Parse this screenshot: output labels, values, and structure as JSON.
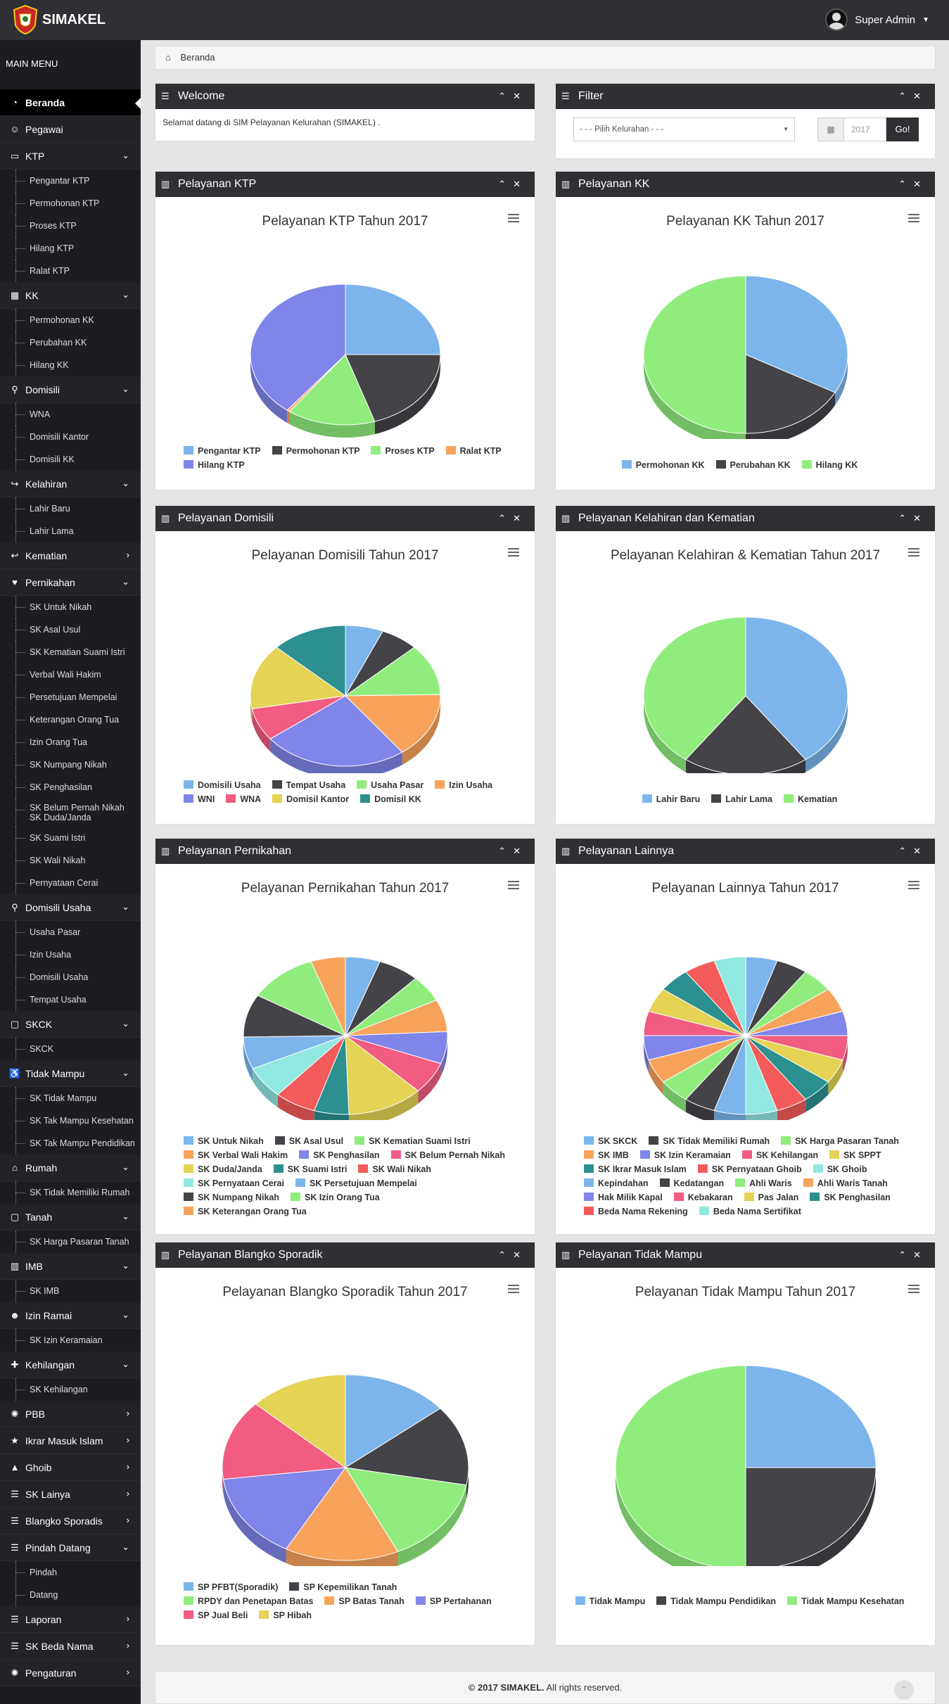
{
  "app": {
    "title": "SIMAKEL",
    "user": "Super Admin"
  },
  "sidebar": {
    "heading": "MAIN MENU",
    "items": [
      {
        "type": "item",
        "label": "Beranda",
        "icon": "dashboard-icon",
        "active": true
      },
      {
        "type": "item",
        "label": "Pegawai",
        "icon": "user-icon"
      },
      {
        "type": "item",
        "label": "KTP",
        "icon": "id-card-icon",
        "chev": "down"
      },
      {
        "type": "sub",
        "label": "Pengantar KTP"
      },
      {
        "type": "sub",
        "label": "Permohonan KTP"
      },
      {
        "type": "sub",
        "label": "Proses KTP"
      },
      {
        "type": "sub",
        "label": "Hilang KTP"
      },
      {
        "type": "sub",
        "label": "Ralat KTP"
      },
      {
        "type": "item",
        "label": "KK",
        "icon": "grid-icon",
        "chev": "down"
      },
      {
        "type": "sub",
        "label": "Permohonan KK"
      },
      {
        "type": "sub",
        "label": "Perubahan KK"
      },
      {
        "type": "sub",
        "label": "Hilang KK"
      },
      {
        "type": "item",
        "label": "Domisili",
        "icon": "map-marker-icon",
        "chev": "down"
      },
      {
        "type": "sub",
        "label": "WNA"
      },
      {
        "type": "sub",
        "label": "Domisili Kantor"
      },
      {
        "type": "sub",
        "label": "Domisili KK"
      },
      {
        "type": "item",
        "label": "Kelahiran",
        "icon": "share-icon",
        "chev": "down"
      },
      {
        "type": "sub",
        "label": "Lahir Baru"
      },
      {
        "type": "sub",
        "label": "Lahir Lama"
      },
      {
        "type": "item",
        "label": "Kematian",
        "icon": "reply-icon",
        "chev": "right"
      },
      {
        "type": "item",
        "label": "Pernikahan",
        "icon": "heart-icon",
        "chev": "down"
      },
      {
        "type": "sub",
        "label": "SK Untuk Nikah"
      },
      {
        "type": "sub",
        "label": "SK Asal Usul"
      },
      {
        "type": "sub",
        "label": "SK Kematian Suami Istri"
      },
      {
        "type": "sub",
        "label": "Verbal Wali Hakim"
      },
      {
        "type": "sub",
        "label": "Persetujuan Mempelai"
      },
      {
        "type": "sub",
        "label": "Keterangan Orang Tua"
      },
      {
        "type": "sub",
        "label": "Izin Orang Tua"
      },
      {
        "type": "sub",
        "label": "SK Numpang Nikah"
      },
      {
        "type": "sub",
        "label": "SK Penghasilan"
      },
      {
        "type": "sub2",
        "label": "SK Belum Pernah Nikah SK Duda/Janda"
      },
      {
        "type": "sub",
        "label": "SK Suami Istri"
      },
      {
        "type": "sub",
        "label": "SK Wali Nikah"
      },
      {
        "type": "sub",
        "label": "Pernyataan Cerai"
      },
      {
        "type": "item",
        "label": "Domisili Usaha",
        "icon": "map-marker-icon",
        "chev": "down"
      },
      {
        "type": "sub",
        "label": "Usaha Pasar"
      },
      {
        "type": "sub",
        "label": "Izin Usaha"
      },
      {
        "type": "sub",
        "label": "Domisili Usaha"
      },
      {
        "type": "sub",
        "label": "Tempat Usaha"
      },
      {
        "type": "item",
        "label": "SKCK",
        "icon": "folder-icon",
        "chev": "down"
      },
      {
        "type": "sub",
        "label": "SKCK"
      },
      {
        "type": "item",
        "label": "Tidak Mampu",
        "icon": "wheelchair-icon",
        "chev": "down"
      },
      {
        "type": "sub",
        "label": "SK Tidak Mampu"
      },
      {
        "type": "sub",
        "label": "SK Tak Mampu Kesehatan"
      },
      {
        "type": "sub",
        "label": "SK Tak Mampu Pendidikan"
      },
      {
        "type": "item",
        "label": "Rumah",
        "icon": "home-icon",
        "chev": "down"
      },
      {
        "type": "sub",
        "label": "SK Tidak Memiliki Rumah"
      },
      {
        "type": "item",
        "label": "Tanah",
        "icon": "folder-icon",
        "chev": "down"
      },
      {
        "type": "sub",
        "label": "SK Harga Pasaran Tanah"
      },
      {
        "type": "item",
        "label": "IMB",
        "icon": "building-icon",
        "chev": "down"
      },
      {
        "type": "sub",
        "label": "SK IMB"
      },
      {
        "type": "item",
        "label": "Izin Ramai",
        "icon": "users-icon",
        "chev": "down"
      },
      {
        "type": "sub",
        "label": "SK Izin Keramaian"
      },
      {
        "type": "item",
        "label": "Kehilangan",
        "icon": "puzzle-icon",
        "chev": "down"
      },
      {
        "type": "sub",
        "label": "SK Kehilangan"
      },
      {
        "type": "item",
        "label": "PBB",
        "icon": "gear-icon",
        "chev": "right"
      },
      {
        "type": "item",
        "label": "Ikrar Masuk Islam",
        "icon": "star-icon",
        "chev": "right"
      },
      {
        "type": "item",
        "label": "Ghoib",
        "icon": "warning-icon",
        "chev": "right"
      },
      {
        "type": "item",
        "label": "SK Lainya",
        "icon": "list-icon",
        "chev": "right"
      },
      {
        "type": "item",
        "label": "Blangko Sporadis",
        "icon": "list-icon",
        "chev": "right"
      },
      {
        "type": "item",
        "label": "Pindah Datang",
        "icon": "list-icon",
        "chev": "down"
      },
      {
        "type": "sub",
        "label": "Pindah"
      },
      {
        "type": "sub",
        "label": "Datang"
      },
      {
        "type": "item",
        "label": "Laporan",
        "icon": "list-icon",
        "chev": "right"
      },
      {
        "type": "item",
        "label": "SK Beda Nama",
        "icon": "list-icon",
        "chev": "right"
      },
      {
        "type": "item",
        "label": "Pengaturan",
        "icon": "gear-icon",
        "chev": "right"
      }
    ]
  },
  "breadcrumb": "Beranda",
  "welcome": {
    "title": "Welcome",
    "text": "Selamat datang di SIM Pelayanan Kelurahan (SIMAKEL) ."
  },
  "filter": {
    "title": "Filter",
    "select": "- - - Pilih Kelurahan - - -",
    "year": "2017",
    "button": "Go!"
  },
  "footer": {
    "bold": "© 2017 SIMAKEL.",
    "rest": " All rights reserved."
  },
  "colors": [
    "#7cb5ec",
    "#434348",
    "#90ed7d",
    "#f7a35c",
    "#8085e9",
    "#f15c80",
    "#e4d354",
    "#2b908f",
    "#f45b5b",
    "#91e8e1"
  ],
  "chart_data": [
    {
      "panel": "Pelayanan KTP",
      "type": "pie",
      "title": "Pelayanan KTP Tahun 2017",
      "categories": [
        "Pengantar KTP",
        "Permohonan KTP",
        "Proses KTP",
        "Ralat KTP",
        "Hilang KTP"
      ],
      "values": [
        25,
        20,
        15,
        0.5,
        39.5
      ]
    },
    {
      "panel": "Pelayanan KK",
      "type": "pie",
      "title": "Pelayanan KK Tahun 2017",
      "categories": [
        "Permohonan KK",
        "Perubahan KK",
        "Hilang KK"
      ],
      "values": [
        33,
        17,
        50
      ]
    },
    {
      "panel": "Pelayanan Domisili",
      "type": "pie",
      "title": "Pelayanan Domisili Tahun 2017",
      "categories": [
        "Domisili Usaha",
        "Tempat Usaha",
        "Usaha Pasar",
        "Izin Usaha",
        "WNI",
        "WNA",
        "Domisil Kantor",
        "Domisil KK"
      ],
      "values": [
        6,
        6,
        11,
        14,
        23,
        7,
        14,
        12
      ]
    },
    {
      "panel": "Pelayanan Kelahiran dan Kematian",
      "type": "pie",
      "title": "Pelayanan Kelahiran & Kematian Tahun 2017",
      "categories": [
        "Lahir Baru",
        "Lahir Lama",
        "Kematian"
      ],
      "values": [
        40,
        20,
        40
      ]
    },
    {
      "panel": "Pelayanan Pernikahan",
      "type": "pie",
      "title": "Pelayanan Pernikahan Tahun 2017",
      "categories": [
        "SK Untuk Nikah",
        "SK Asal Usul",
        "SK Kematian Suami Istri",
        "SK Verbal Wali Hakim",
        "SK Penghasilan",
        "SK Belum Pernah Nikah",
        "SK Duda/Janda",
        "SK Suami Istri",
        "SK Wali Nikah",
        "SK Pernyataan Cerai",
        "SK Persetujuan Mempelai",
        "SK Numpang Nikah",
        "SK Izin Orang Tua",
        "SK Keterangan Orang Tua"
      ],
      "values": [
        5,
        6,
        5,
        6,
        6,
        6,
        11,
        5,
        6,
        6,
        6,
        8,
        10,
        5
      ]
    },
    {
      "panel": "Pelayanan Lainnya",
      "type": "pie",
      "title": "Pelayanan Lainnya Tahun 2017",
      "categories": [
        "SK SKCK",
        "SK Tidak Memiliki Rumah",
        "SK Harga Pasaran Tanah",
        "SK IMB",
        "SK Izin Keramaian",
        "SK Kehilangan",
        "SK SPPT",
        "SK Ikrar Masuk Islam",
        "SK Pernyataan Ghoib",
        "SK Ghoib",
        "Kepindahan",
        "Kedatangan",
        "Ahli Waris",
        "Ahli Waris Tanah",
        "Hak Milik Kapal",
        "Kebakaran",
        "Pas Jalan",
        "SK Penghasilan",
        "Beda Nama Rekening",
        "Beda Nama Sertifikat"
      ],
      "values": [
        5,
        5,
        5,
        5,
        5,
        5,
        5,
        5,
        5,
        5,
        5,
        5,
        5,
        5,
        5,
        5,
        5,
        5,
        5,
        5
      ]
    },
    {
      "panel": "Pelayanan Blangko Sporadik",
      "type": "pie",
      "title": "Pelayanan Blangko Sporadik Tahun 2017",
      "categories": [
        "SP PFBT(Sporadik)",
        "SP Kepemilikan Tanah",
        "RPDY dan Penetapan Batas",
        "SP Batas Tanah",
        "SP Pertahanan",
        "SP Jual Beli",
        "SP Hibah"
      ],
      "values": [
        14,
        14,
        15,
        15,
        15,
        14,
        13
      ]
    },
    {
      "panel": "Pelayanan Tidak Mampu",
      "type": "pie",
      "title": "Pelayanan Tidak Mampu Tahun 2017",
      "categories": [
        "Tidak Mampu",
        "Tidak Mampu Pendidikan",
        "Tidak Mampu Kesehatan"
      ],
      "values": [
        25,
        25,
        50
      ]
    }
  ]
}
